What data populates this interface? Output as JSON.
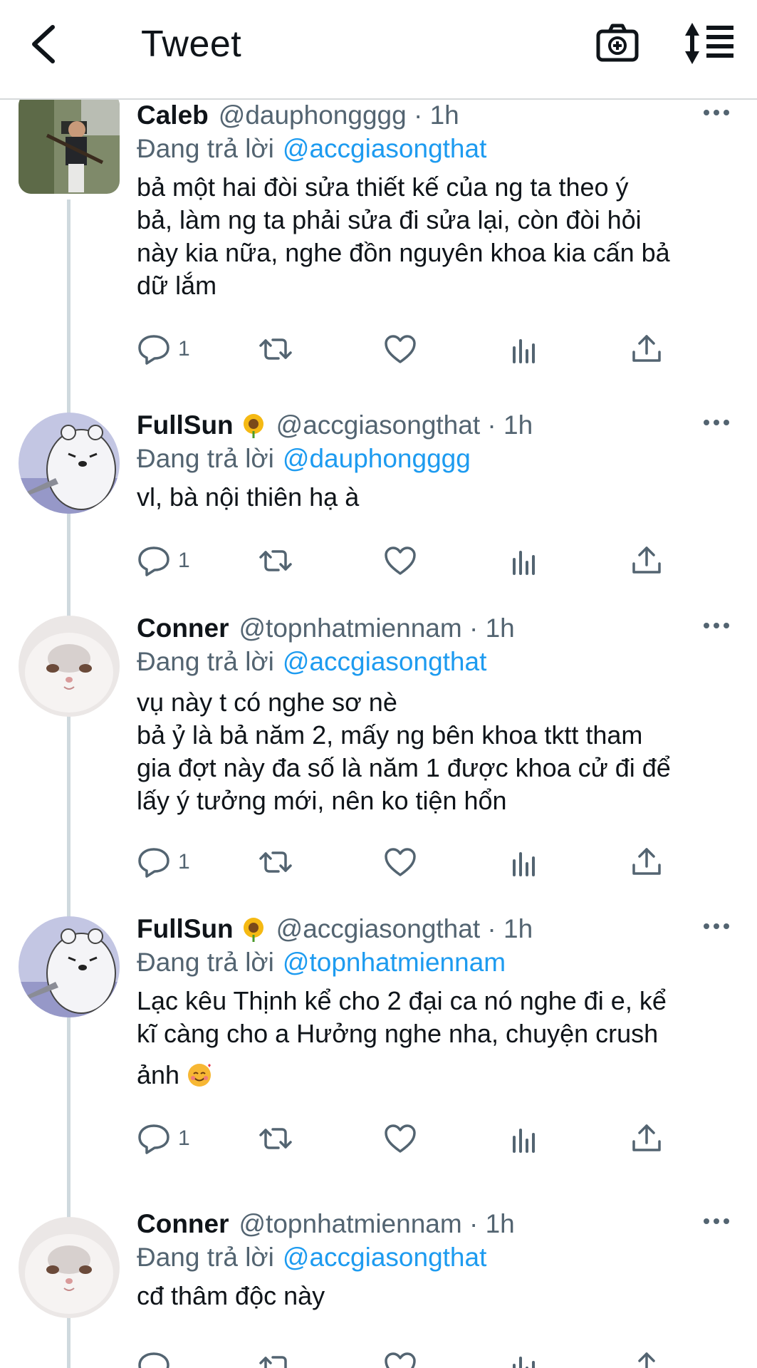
{
  "header": {
    "title": "Tweet"
  },
  "icons": {
    "back": "arrow-left-icon",
    "camera": "camera-add-icon",
    "sort": "sort-replies-icon",
    "more": "more-horizontal-icon",
    "reply": "reply-icon",
    "retweet": "retweet-icon",
    "like": "heart-icon",
    "stats": "analytics-icon",
    "share": "share-icon"
  },
  "colors": {
    "link": "#1d9bf0",
    "secondary_text": "#536471",
    "primary_text": "#0f1419",
    "thread_line": "#cfd9de"
  },
  "tweets": [
    {
      "display_name": "Caleb",
      "emoji": "",
      "handle": "@dauphongggg",
      "time": " · 1h",
      "replying_label": "Đang trả lời",
      "replying_to": "@accgiasongthat",
      "lines": [
        "bả một hai đòi sửa thiết kế của ng ta theo ý",
        "bả, làm ng ta phải sửa đi sửa lại, còn đòi hỏi",
        "này kia nữa, nghe đồn nguyên khoa kia cấn bả",
        "dữ lắm"
      ],
      "reply_count": "1",
      "retweet_count": "",
      "like_count": ""
    },
    {
      "display_name": "FullSun",
      "emoji": "sunflower-emoji",
      "handle": "@accgiasongthat",
      "time": " · 1h",
      "replying_label": "Đang trả lời",
      "replying_to": "@dauphongggg",
      "lines": [
        "vl, bà nội thiên hạ à"
      ],
      "reply_count": "1",
      "retweet_count": "",
      "like_count": ""
    },
    {
      "display_name": "Conner",
      "emoji": "",
      "handle": "@topnhatmiennam",
      "time": " · 1h",
      "replying_label": "Đang trả lời",
      "replying_to": "@accgiasongthat",
      "lines": [
        "vụ này t có nghe sơ nè",
        "bả ỷ là bả năm 2, mấy ng bên khoa tktt tham",
        "gia đợt này đa số là năm 1 được khoa cử đi để",
        "lấy ý tưởng mới, nên ko tiện hổn"
      ],
      "reply_count": "1",
      "retweet_count": "",
      "like_count": ""
    },
    {
      "display_name": "FullSun",
      "emoji": "sunflower-emoji",
      "handle": "@accgiasongthat",
      "time": " · 1h",
      "replying_label": "Đang trả lời",
      "replying_to": "@topnhatmiennam",
      "lines": [
        "Lạc kêu Thịnh kể cho 2 đại ca nó nghe đi e, kể",
        "kĩ càng cho a Hưởng nghe nha, chuyện crush",
        "ảnh"
      ],
      "trailing_emoji": "smiling-face-with-hearts-emoji",
      "reply_count": "1",
      "retweet_count": "",
      "like_count": ""
    },
    {
      "display_name": "Conner",
      "emoji": "",
      "handle": "@topnhatmiennam",
      "time": " · 1h",
      "replying_label": "Đang trả lời",
      "replying_to": "@accgiasongthat",
      "lines": [
        "cđ thâm độc này"
      ],
      "reply_count": "",
      "retweet_count": "",
      "like_count": ""
    }
  ]
}
